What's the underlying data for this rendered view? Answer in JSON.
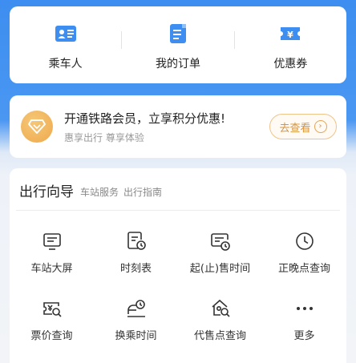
{
  "quick_links": [
    {
      "label": "乘车人",
      "icon": "passenger-card-icon"
    },
    {
      "label": "我的订单",
      "icon": "order-document-icon"
    },
    {
      "label": "优惠券",
      "icon": "coupon-ticket-icon"
    }
  ],
  "vip_banner": {
    "title": "开通铁路会员，立享积分优惠!",
    "subtitle": "惠享出行 尊享体验",
    "button_label": "去查看",
    "icon": "diamond-badge-icon"
  },
  "guide": {
    "title": "出行向导",
    "tabs": [
      "车站服务",
      "出行指南"
    ],
    "items": [
      {
        "label": "车站大屏",
        "icon": "station-screen-icon"
      },
      {
        "label": "时刻表",
        "icon": "timetable-icon"
      },
      {
        "label": "起(止)售时间",
        "icon": "sale-time-icon"
      },
      {
        "label": "正晚点查询",
        "icon": "clock-icon"
      },
      {
        "label": "票价查询",
        "icon": "fare-search-icon"
      },
      {
        "label": "换乘时间",
        "icon": "transfer-time-icon"
      },
      {
        "label": "代售点查询",
        "icon": "agency-search-icon"
      },
      {
        "label": "更多",
        "icon": "more-dots-icon"
      }
    ]
  },
  "colors": {
    "primary_blue": "#3d8ef0",
    "gold": "#eea94c",
    "text": "#222222"
  }
}
